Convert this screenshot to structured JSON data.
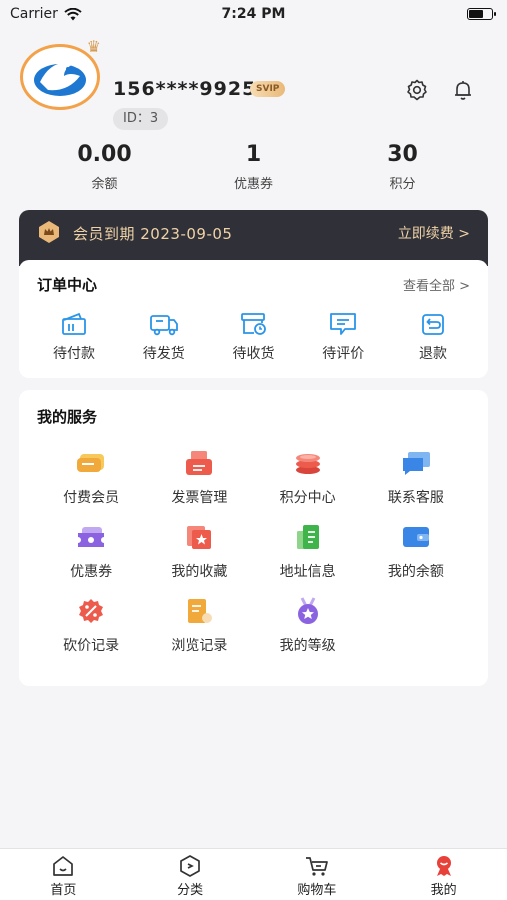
{
  "status_bar": {
    "carrier": "Carrier",
    "time": "7:24 PM"
  },
  "profile": {
    "phone": "156****9925",
    "svip_badge": "SVIP",
    "id_label": "ID：3"
  },
  "stats": [
    {
      "value": "0.00",
      "label": "余额"
    },
    {
      "value": "1",
      "label": "优惠券"
    },
    {
      "value": "30",
      "label": "积分"
    }
  ],
  "vip_banner": {
    "text": "会员到期 2023-09-05",
    "action": "立即续费 >"
  },
  "orders": {
    "title": "订单中心",
    "more": "查看全部 >",
    "items": [
      {
        "label": "待付款",
        "icon": "wallet-icon"
      },
      {
        "label": "待发货",
        "icon": "truck-icon"
      },
      {
        "label": "待收货",
        "icon": "box-clock-icon"
      },
      {
        "label": "待评价",
        "icon": "comment-icon"
      },
      {
        "label": "退款",
        "icon": "refund-icon"
      }
    ]
  },
  "services": {
    "title": "我的服务",
    "items": [
      {
        "label": "付费会员",
        "icon": "member-card-icon"
      },
      {
        "label": "发票管理",
        "icon": "invoice-icon"
      },
      {
        "label": "积分中心",
        "icon": "coins-icon"
      },
      {
        "label": "联系客服",
        "icon": "chat-icon"
      },
      {
        "label": "优惠券",
        "icon": "coupon-icon"
      },
      {
        "label": "我的收藏",
        "icon": "favorite-icon"
      },
      {
        "label": "地址信息",
        "icon": "address-icon"
      },
      {
        "label": "我的余额",
        "icon": "balance-icon"
      },
      {
        "label": "砍价记录",
        "icon": "bargain-icon"
      },
      {
        "label": "浏览记录",
        "icon": "history-icon"
      },
      {
        "label": "我的等级",
        "icon": "level-medal-icon"
      }
    ]
  },
  "tabbar": [
    {
      "label": "首页",
      "icon": "home-icon"
    },
    {
      "label": "分类",
      "icon": "category-icon"
    },
    {
      "label": "购物车",
      "icon": "cart-icon"
    },
    {
      "label": "我的",
      "icon": "profile-icon"
    }
  ],
  "colors": {
    "accent_blue": "#2a95e8",
    "vip_dark": "#2f3038",
    "vip_gold": "#f0d2a6"
  }
}
